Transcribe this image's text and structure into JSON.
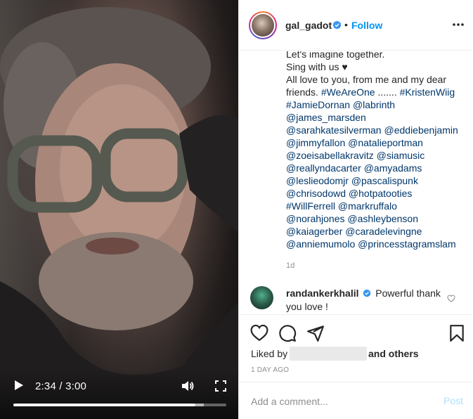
{
  "video": {
    "time_label": "2:34 / 3:00",
    "progress_fraction": 0.8556,
    "buffered_fraction": 0.895
  },
  "header": {
    "username": "gal_gadot",
    "separator": "•",
    "follow_label": "Follow"
  },
  "caption": {
    "lines": [
      [
        {
          "t": "Let's imagine together.",
          "tag": false
        }
      ],
      [
        {
          "t": "Sing with us ",
          "tag": false
        },
        {
          "t": "♥",
          "tag": false
        }
      ],
      [
        {
          "t": "All love to you, from me and my dear",
          "tag": false
        }
      ],
      [
        {
          "t": "friends. ",
          "tag": false
        },
        {
          "t": "#WeAreOne",
          "tag": true
        },
        {
          "t": " ....... ",
          "tag": false
        },
        {
          "t": "#KristenWiig",
          "tag": true
        }
      ],
      [
        {
          "t": "#JamieDornan",
          "tag": true
        },
        {
          "t": " ",
          "tag": false
        },
        {
          "t": "@labrinth",
          "tag": true
        }
      ],
      [
        {
          "t": "@james_marsden",
          "tag": true
        }
      ],
      [
        {
          "t": "@sarahkatesilverman",
          "tag": true
        },
        {
          "t": " ",
          "tag": false
        },
        {
          "t": "@eddiebenjamin",
          "tag": true
        }
      ],
      [
        {
          "t": "@jimmyfallon",
          "tag": true
        },
        {
          "t": " ",
          "tag": false
        },
        {
          "t": "@natalieportman",
          "tag": true
        }
      ],
      [
        {
          "t": "@zoeisabellakravitz",
          "tag": true
        },
        {
          "t": " ",
          "tag": false
        },
        {
          "t": "@siamusic",
          "tag": true
        }
      ],
      [
        {
          "t": "@reallyndacarter",
          "tag": true
        },
        {
          "t": " ",
          "tag": false
        },
        {
          "t": "@amyadams",
          "tag": true
        }
      ],
      [
        {
          "t": "@leslieodomjr",
          "tag": true
        },
        {
          "t": " ",
          "tag": false
        },
        {
          "t": "@pascalispunk",
          "tag": true
        }
      ],
      [
        {
          "t": "@chrisodowd",
          "tag": true
        },
        {
          "t": " ",
          "tag": false
        },
        {
          "t": "@hotpatooties",
          "tag": true
        }
      ],
      [
        {
          "t": "#WillFerrell",
          "tag": true
        },
        {
          "t": " ",
          "tag": false
        },
        {
          "t": "@markruffalo",
          "tag": true
        }
      ],
      [
        {
          "t": "@norahjones",
          "tag": true
        },
        {
          "t": " ",
          "tag": false
        },
        {
          "t": "@ashleybenson",
          "tag": true
        }
      ],
      [
        {
          "t": "@kaiagerber",
          "tag": true
        },
        {
          "t": " ",
          "tag": false
        },
        {
          "t": "@caradelevingne",
          "tag": true
        }
      ],
      [
        {
          "t": "@anniemumolo",
          "tag": true
        },
        {
          "t": " ",
          "tag": false
        },
        {
          "t": "@princesstagramslam",
          "tag": true
        }
      ]
    ],
    "age": "1d"
  },
  "comment": {
    "username": "randankerkhalil",
    "text": "Powerful thank you love !"
  },
  "actions": {
    "liked_by_label": "Liked by",
    "others_label": "and others",
    "time_ago": "1 DAY AGO"
  },
  "add_comment": {
    "placeholder": "Add a comment...",
    "post_label": "Post"
  },
  "colors": {
    "link": "#00376b",
    "follow": "#0095f6",
    "verified": "#3897f0",
    "post_disabled": "#b2dffc",
    "muted": "#8e8e8e"
  },
  "icons": {
    "header": [
      "verified-badge-icon",
      "more-options-icon"
    ],
    "actions": [
      "heart-icon",
      "comment-icon",
      "share-icon",
      "bookmark-icon"
    ],
    "video": [
      "play-icon",
      "volume-icon",
      "fullscreen-icon"
    ]
  }
}
